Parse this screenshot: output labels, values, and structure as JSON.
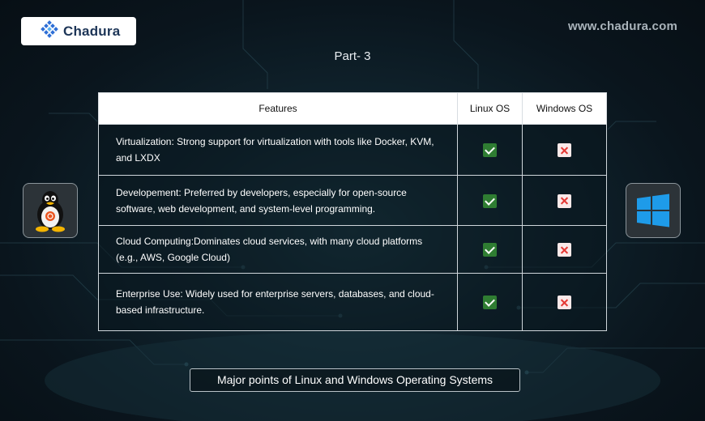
{
  "brand": {
    "name": "Chadura",
    "url": "www.chadura.com"
  },
  "part_title": "Part- 3",
  "table": {
    "headers": [
      "Features",
      "Linux OS",
      "Windows OS"
    ],
    "rows": [
      {
        "feature": "Virtualization: Strong support for virtualization with tools like Docker, KVM, and LXDX",
        "linux": "check",
        "windows": "cross"
      },
      {
        "feature": "Developement: Preferred by developers, especially for open-source software, web development, and system-level programming.",
        "linux": "check",
        "windows": "cross"
      },
      {
        "feature": "Cloud Computing:Dominates cloud services, with many cloud platforms (e.g., AWS, Google Cloud)",
        "linux": "check",
        "windows": "cross"
      },
      {
        "feature": "Enterprise Use: Widely used for enterprise servers, databases, and cloud-based infrastructure.",
        "linux": "check",
        "windows": "cross"
      }
    ]
  },
  "icons": {
    "left": "linux-tux-icon",
    "right": "windows-logo-icon",
    "check": "green-checkmark-icon",
    "cross": "red-cross-icon"
  },
  "colors": {
    "check": "#2f7d32",
    "cross": "#e53935",
    "windows_blue": "#1e9be9"
  },
  "caption": "Major points of Linux and Windows Operating Systems"
}
